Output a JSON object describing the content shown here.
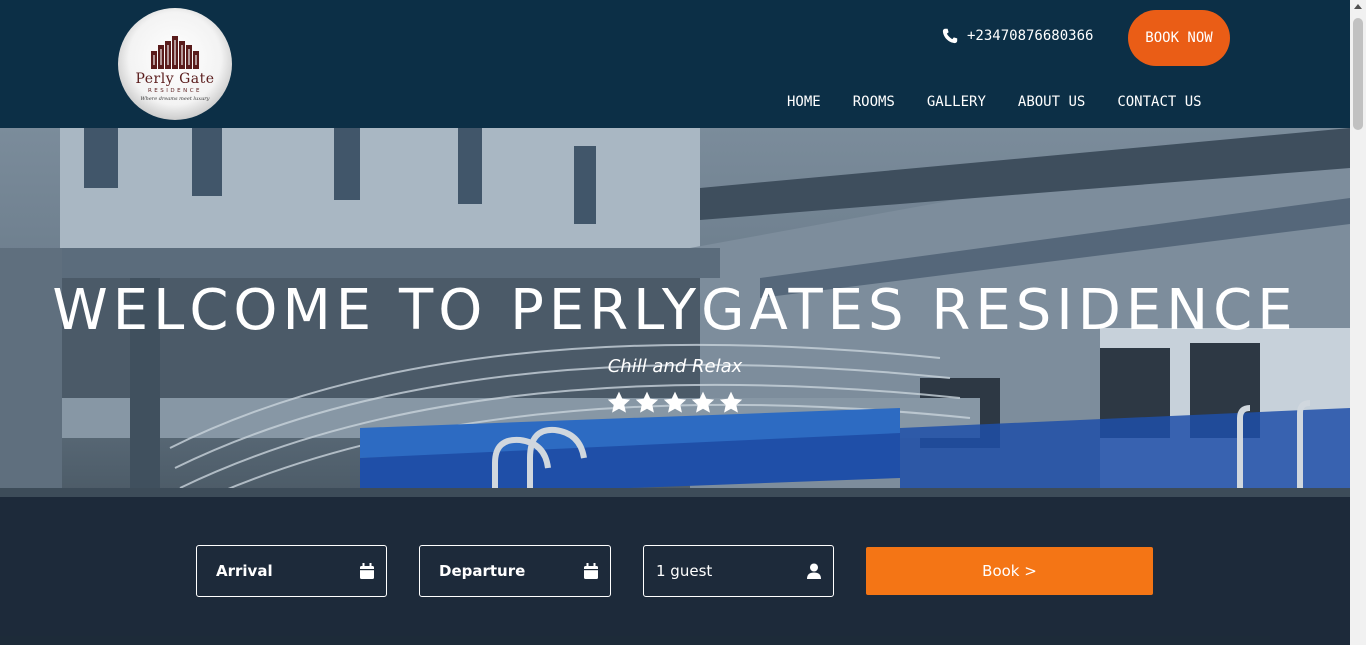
{
  "header": {
    "logo": {
      "name": "Perly Gate",
      "sub": "RESIDENCE",
      "tagline": "Where dreams meet luxury"
    },
    "phone": {
      "icon": "phone-icon",
      "number": "+23470876680366"
    },
    "book_now_label": "BOOK NOW",
    "nav": [
      "HOME",
      "ROOMS",
      "GALLERY",
      "ABOUT US",
      "CONTACT US"
    ]
  },
  "hero": {
    "title": "WELCOME TO PERLYGATES RESIDENCE",
    "subtitle": "Chill and Relax",
    "rating_stars": 5
  },
  "booking": {
    "arrival_label": "Arrival",
    "departure_label": "Departure",
    "guests_value": "1 guest",
    "book_button_label": "Book >"
  },
  "colors": {
    "header_bg": "#0c2f46",
    "accent": "#ea5d16",
    "book_button": "#f47515",
    "logo_text": "#5a1c1c"
  }
}
